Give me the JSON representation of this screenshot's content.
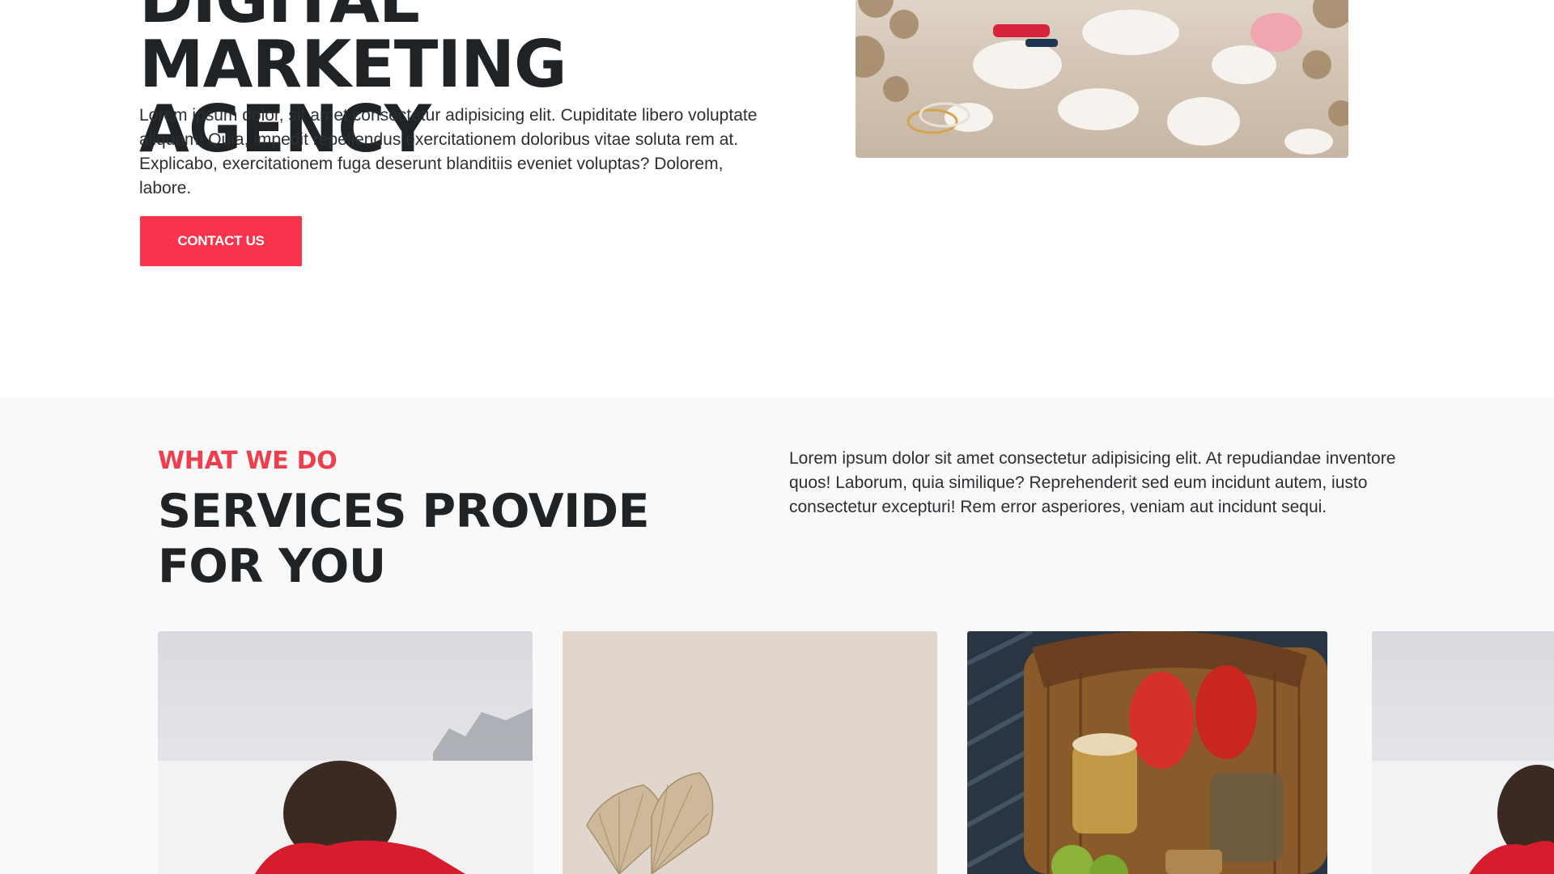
{
  "hero": {
    "title_line1": "DIGITAL MARKETING",
    "title_line2": "AGENCY",
    "description": "Lorem ipsum dolor, sit amet consectetur adipisicing elit. Cupiditate libero voluptate aliquam! Quia, impedit repellendus exercitationem doloribus vitae soluta rem at. Explicabo, exercitationem fuga deserunt blanditiis eveniet voluptas? Dolorem, labore.",
    "contact_label": "CONTACT US"
  },
  "services": {
    "eyebrow": "WHAT WE DO",
    "title": "SERVICES PROVIDE FOR YOU",
    "description": "Lorem ipsum dolor sit amet consectetur adipisicing elit. At repudiandae inventore quos! Laborum, quia similique? Reprehenderit sed eum incidunt autem, iusto consectetur excepturi! Rem error asperiores, veniam aut incidunt sequi."
  },
  "colors": {
    "accent": "#f8334b",
    "heading": "#1f2326",
    "section_bg": "#f9f9f9"
  }
}
